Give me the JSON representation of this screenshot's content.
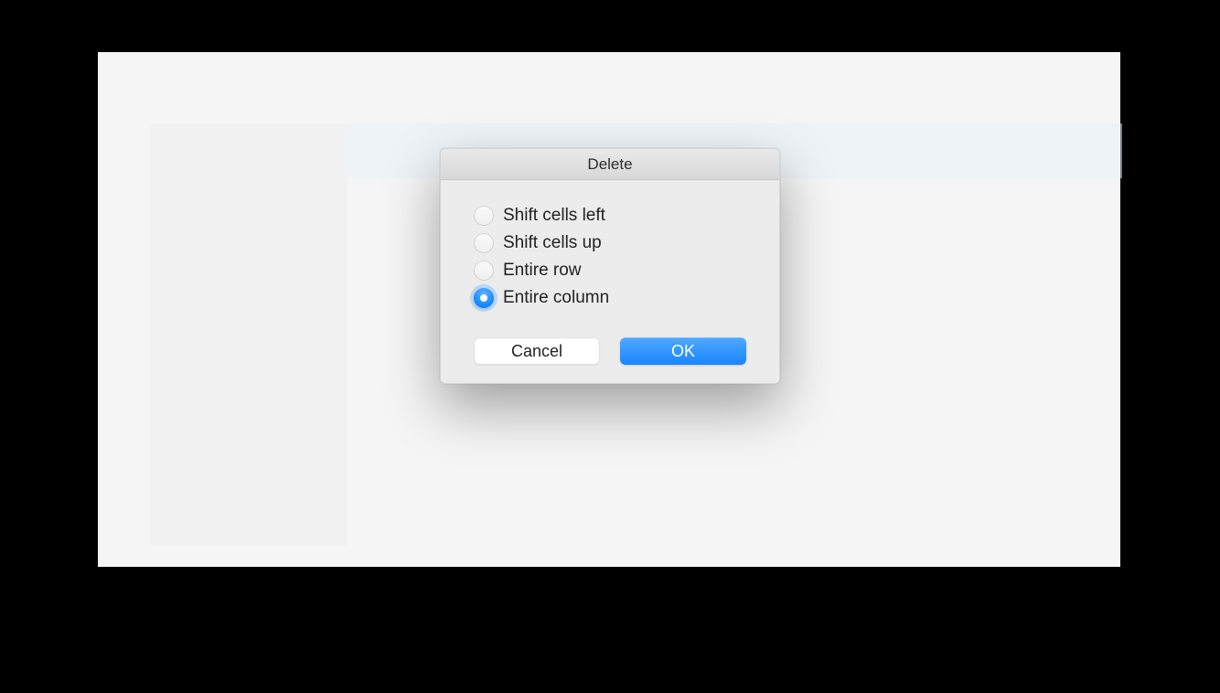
{
  "dialog": {
    "title": "Delete",
    "options": [
      {
        "label": "Shift cells left",
        "selected": false
      },
      {
        "label": "Shift cells up",
        "selected": false
      },
      {
        "label": "Entire row",
        "selected": false
      },
      {
        "label": "Entire column",
        "selected": true
      }
    ],
    "buttons": {
      "cancel_label": "Cancel",
      "ok_label": "OK"
    }
  }
}
